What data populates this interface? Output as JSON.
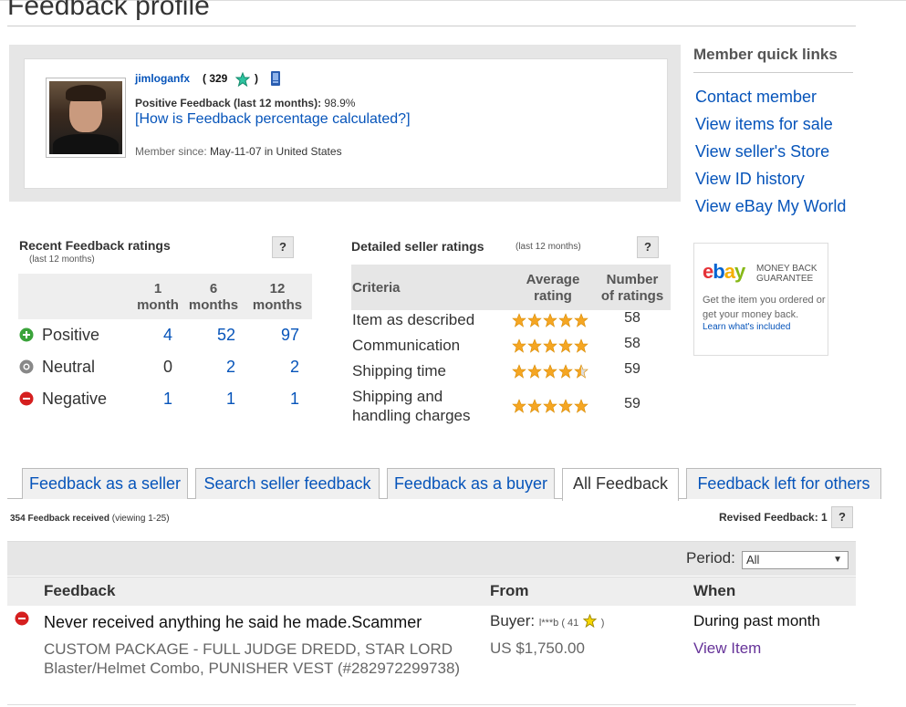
{
  "page": {
    "title": "Feedback profile"
  },
  "profile": {
    "username": "jimloganfx",
    "score_open": "( 329",
    "score_close": ")",
    "positive_label": "Positive Feedback (last 12 months):",
    "positive_value": "98.9%",
    "how_link": "[How is Feedback percentage calculated?]",
    "member_since_label": "Member since:",
    "member_since_value": "May-11-07 in United States"
  },
  "quick_links": {
    "title": "Member quick links",
    "items": [
      "Contact member",
      "View items for sale",
      "View seller's Store",
      "View ID history",
      "View eBay My World"
    ]
  },
  "money_back": {
    "logo": {
      "e": "e",
      "b": "b",
      "a": "a",
      "y": "y"
    },
    "guarantee_line1": "MONEY BACK",
    "guarantee_line2": "GUARANTEE",
    "text": "Get the item you ordered or get your money back.",
    "learn": "Learn what's included"
  },
  "help": "?",
  "recent_ratings": {
    "title": "Recent Feedback ratings",
    "subtitle": "(last 12 months)",
    "columns": [
      {
        "line1": "1",
        "line2": "month"
      },
      {
        "line1": "6",
        "line2": "months"
      },
      {
        "line1": "12",
        "line2": "months"
      }
    ],
    "rows": [
      {
        "label": "Positive",
        "values": [
          "4",
          "52",
          "97"
        ]
      },
      {
        "label": "Neutral",
        "values": [
          "0",
          "2",
          "2"
        ]
      },
      {
        "label": "Negative",
        "values": [
          "1",
          "1",
          "1"
        ]
      }
    ]
  },
  "detailed_ratings": {
    "title": "Detailed seller ratings",
    "subtitle": "(last 12 months)",
    "col_criteria": "Criteria",
    "col_avg_1": "Average",
    "col_avg_2": "rating",
    "col_num_1": "Number",
    "col_num_2": "of ratings",
    "rows": [
      {
        "criteria": "Item as described",
        "stars": 5,
        "count": "58"
      },
      {
        "criteria": "Communication",
        "stars": 5,
        "count": "58"
      },
      {
        "criteria": "Shipping time",
        "stars": 4.5,
        "count": "59"
      },
      {
        "criteria_1": "Shipping and",
        "criteria_2": "handling charges",
        "stars": 5,
        "count": "59"
      }
    ]
  },
  "tabs": [
    "Feedback as a seller",
    "Search seller feedback",
    "Feedback as a buyer",
    "All Feedback",
    "Feedback left for others"
  ],
  "summary": {
    "received_bold": "354 Feedback received",
    "received_rest": "(viewing 1-25)",
    "revised": "Revised Feedback: 1"
  },
  "period": {
    "label": "Period:",
    "selected": "All"
  },
  "table": {
    "headers": {
      "feedback": "Feedback",
      "from": "From",
      "when": "When"
    },
    "rows": [
      {
        "type": "negative",
        "text": "Never received anything he said he made.Scammer",
        "item": "CUSTOM PACKAGE - FULL JUDGE DREDD, STAR LORD Blaster/Helmet Combo, PUNISHER VEST (#282972299738)",
        "buyer_label": "Buyer:",
        "buyer_name": "l***b ( 41",
        "buyer_close": ")",
        "price": "US $1,750.00",
        "when": "During past month",
        "view_item": "View Item"
      }
    ]
  },
  "colors": {
    "link": "#0654ba",
    "positive": "#3aa33a",
    "neutral": "#888888",
    "negative": "#d51f1f",
    "star_orange": "#f5a623",
    "star_green": "#2ec4a0",
    "star_yellow": "#f8d800",
    "visited_link": "#663399"
  }
}
